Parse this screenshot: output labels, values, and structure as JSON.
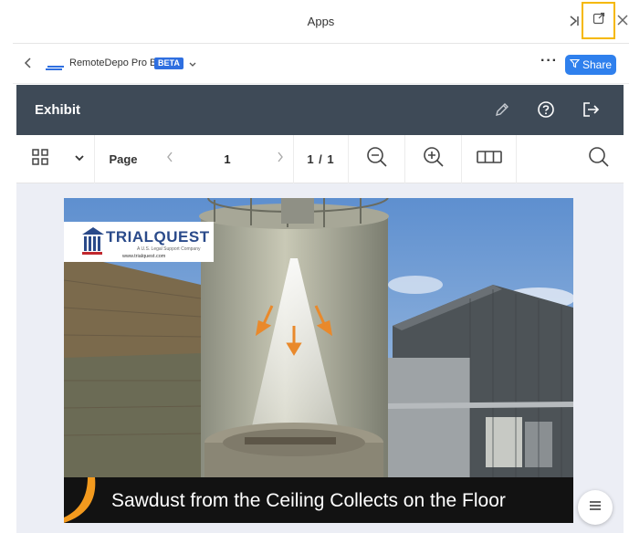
{
  "window": {
    "title": "Apps",
    "icons": [
      "collapse-icon",
      "popout-icon",
      "close-icon"
    ]
  },
  "appbar": {
    "brand_name": "RemoteDepo Pro Beta",
    "beta_badge": "BETA",
    "share_label": "Share",
    "more_label": "···"
  },
  "exhibit": {
    "title": "Exhibit"
  },
  "toolbar": {
    "page_label": "Page",
    "current_page": "1",
    "page_count": "1 / 1"
  },
  "document": {
    "logo_name": "TRIALQUEST",
    "logo_tagline": "A U.S. Legal Support Company",
    "logo_url": "www.trialquest.com",
    "caption": "Sawdust from the Ceiling Collects on the Floor"
  },
  "colors": {
    "accent": "#2f80ed",
    "exhibit_bar": "#3e4a57",
    "highlight": "#f5b800"
  }
}
